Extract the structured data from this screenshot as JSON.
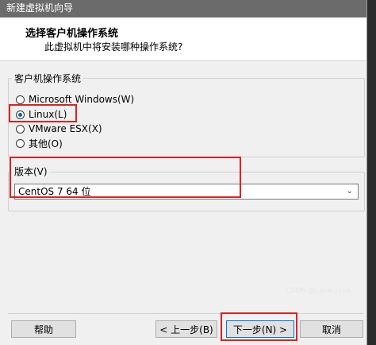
{
  "window": {
    "title": "新建虚拟机向导"
  },
  "header": {
    "title": "选择客户机操作系统",
    "subtitle": "此虚拟机中将安装哪种操作系统?"
  },
  "os_group": {
    "legend": "客户机操作系统",
    "options": [
      {
        "label": "Microsoft Windows(W)",
        "selected": false
      },
      {
        "label": "Linux(L)",
        "selected": true
      },
      {
        "label": "VMware ESX(X)",
        "selected": false
      },
      {
        "label": "其他(O)",
        "selected": false
      }
    ]
  },
  "version_group": {
    "legend": "版本(V)",
    "selected_value": "CentOS 7 64 位"
  },
  "buttons": {
    "help": "帮助",
    "back": "< 上一步(B)",
    "next": "下一步(N) >",
    "cancel": "取消"
  },
  "watermark": "CSDN @Love-Java."
}
